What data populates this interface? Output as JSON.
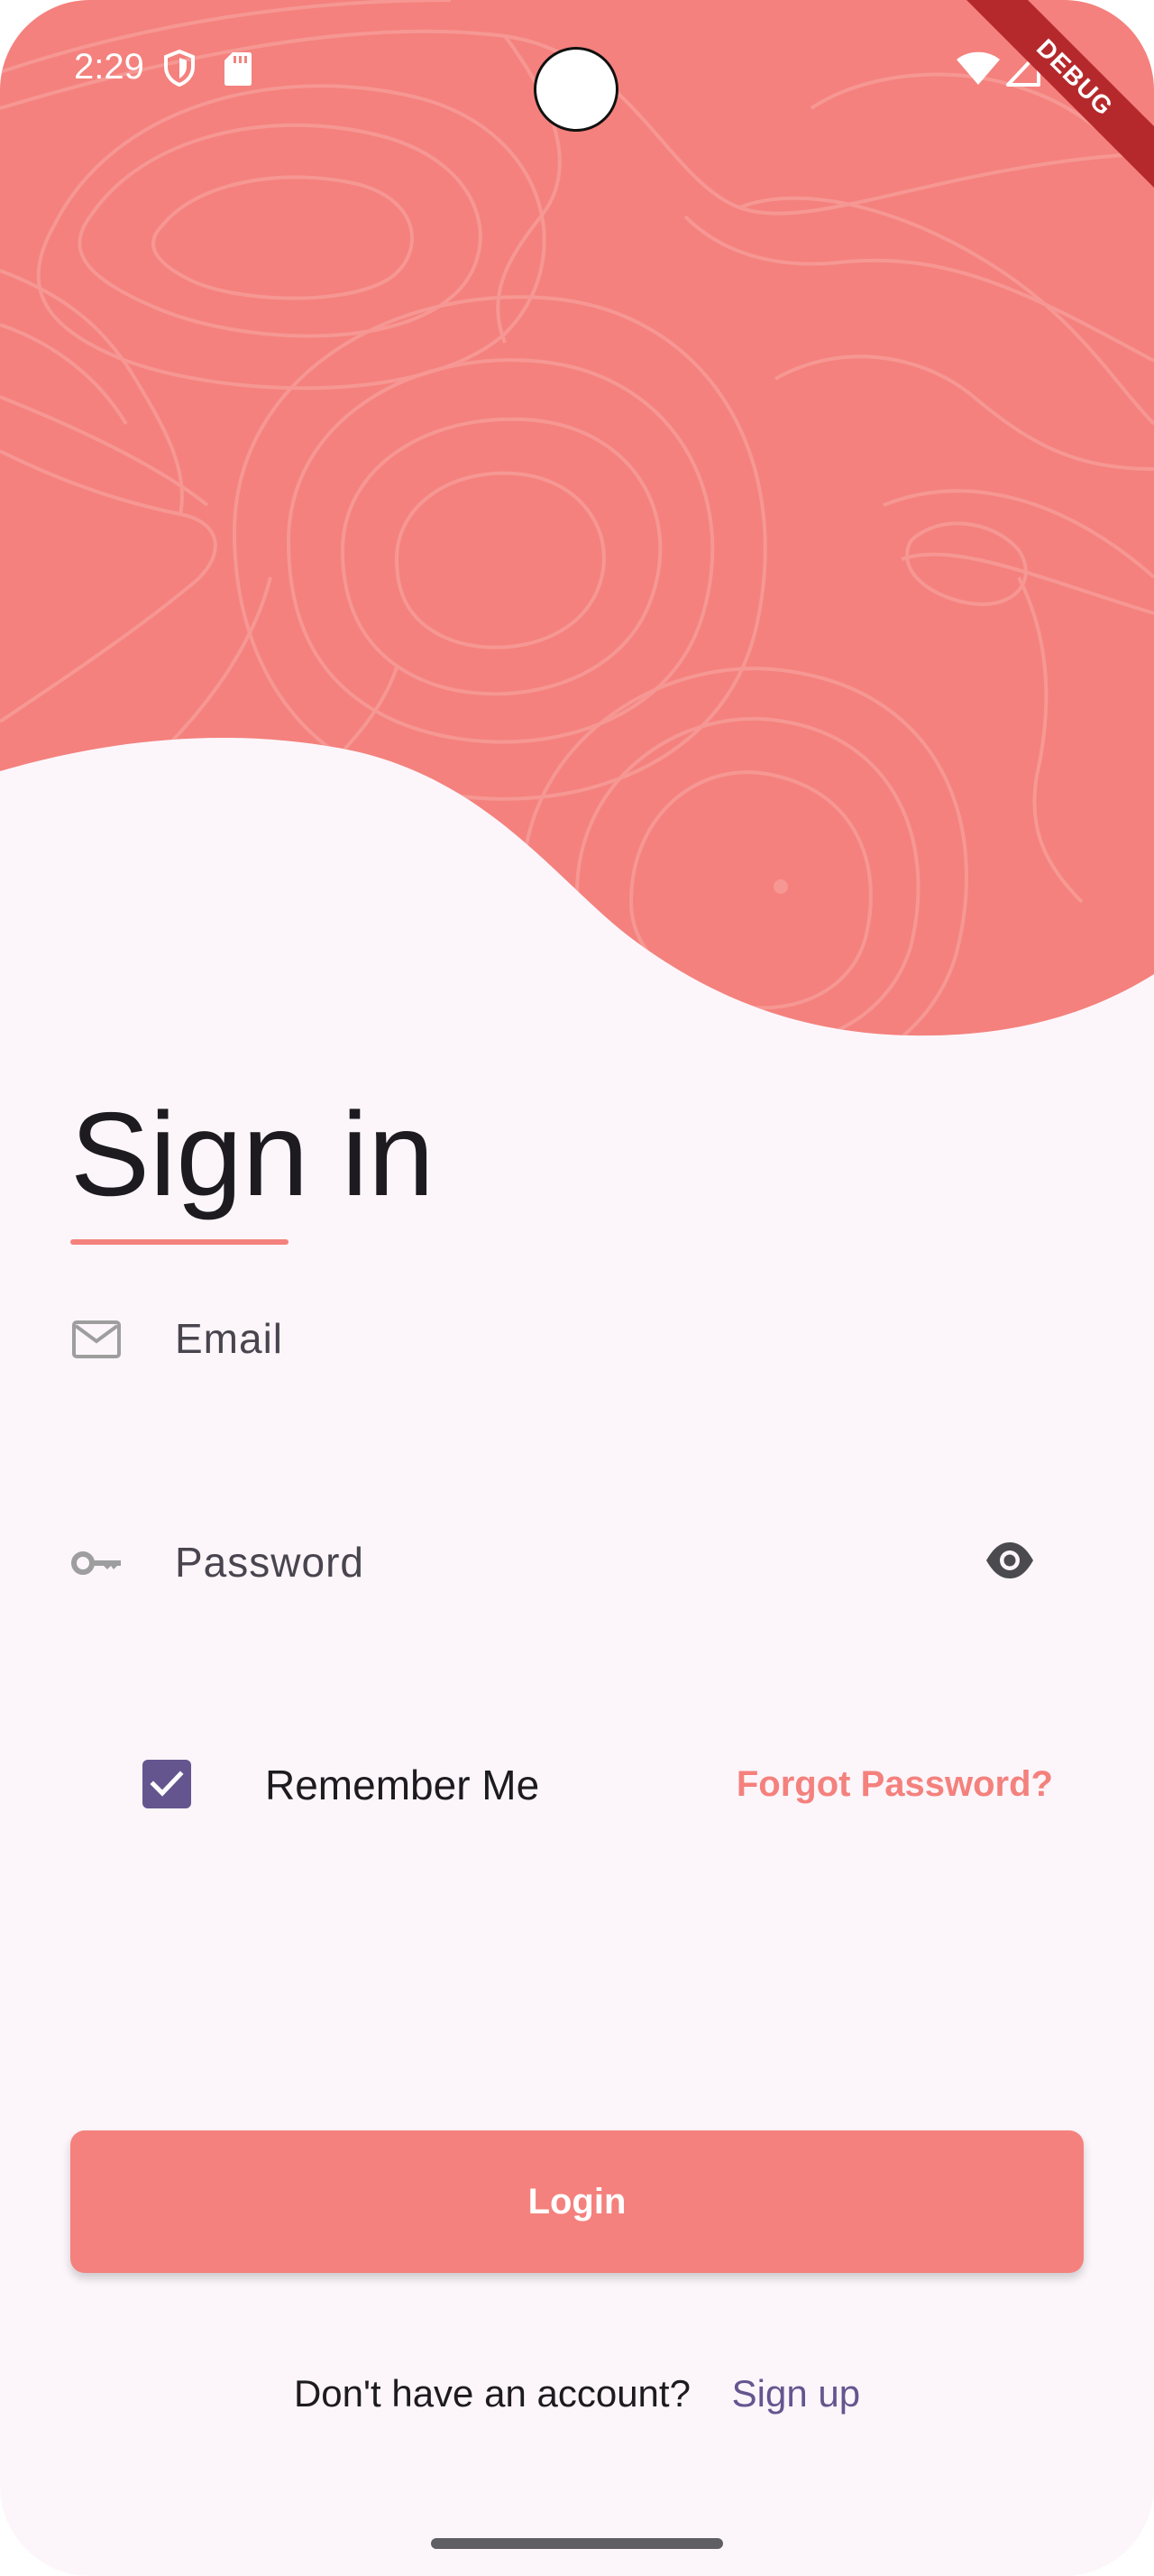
{
  "status_bar": {
    "time": "2:29",
    "icons": [
      "shield-icon",
      "sd-card-icon",
      "wifi-icon",
      "signal-icon",
      "battery-icon"
    ]
  },
  "debug_banner": "DEBUG",
  "header": {
    "background_color": "#f4817d",
    "pattern": "topographic-lines"
  },
  "title": "Sign in",
  "form": {
    "email": {
      "icon": "mail-icon",
      "placeholder": "Email",
      "value": ""
    },
    "password": {
      "icon": "key-icon",
      "placeholder": "Password",
      "value": "",
      "toggle_icon": "eye-icon"
    },
    "remember_me": {
      "label": "Remember Me",
      "checked": true
    },
    "forgot_password": "Forgot Password?"
  },
  "login_button": "Login",
  "signup": {
    "prompt": "Don't have an account?",
    "link": "Sign up"
  },
  "colors": {
    "accent": "#f4817d",
    "primary": "#65558f",
    "background": "#fcf6fb",
    "text": "#1d1b20"
  }
}
